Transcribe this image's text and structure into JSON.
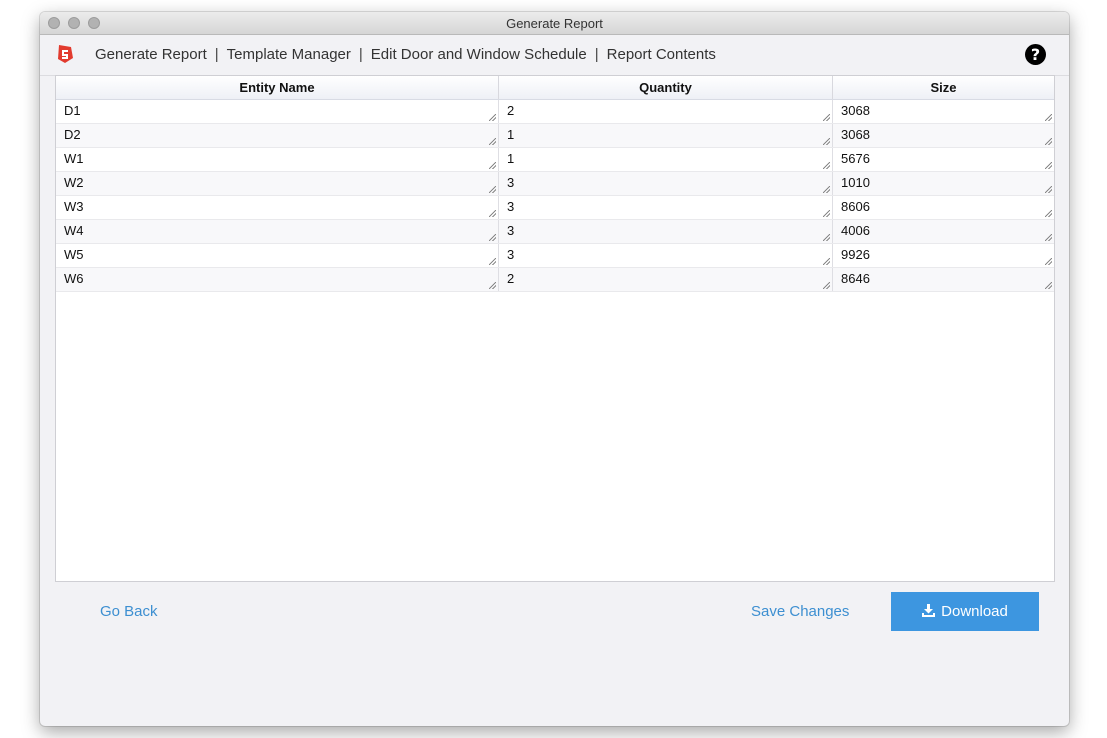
{
  "window": {
    "title": "Generate Report"
  },
  "nav": {
    "links": [
      "Generate Report",
      "Template Manager",
      "Edit Door and Window Schedule",
      "Report Contents"
    ],
    "separator": "|",
    "help_glyph": "?"
  },
  "table": {
    "columns": [
      "Entity Name",
      "Quantity",
      "Size"
    ],
    "rows": [
      [
        "D1",
        "2",
        "3068"
      ],
      [
        "D2",
        "1",
        "3068"
      ],
      [
        "W1",
        "1",
        "5676"
      ],
      [
        "W2",
        "3",
        "1010"
      ],
      [
        "W3",
        "3",
        "8606"
      ],
      [
        "W4",
        "3",
        "4006"
      ],
      [
        "W5",
        "3",
        "9926"
      ],
      [
        "W6",
        "2",
        "8646"
      ]
    ]
  },
  "footer": {
    "go_back": "Go Back",
    "save_changes": "Save Changes",
    "download": "Download"
  },
  "icons": {
    "logo": "sketchup-logo-icon",
    "help": "help-icon",
    "download": "download-icon"
  },
  "colors": {
    "accent": "#3d96e0",
    "link": "#3d8fd1",
    "logo": "#e23b2e"
  }
}
